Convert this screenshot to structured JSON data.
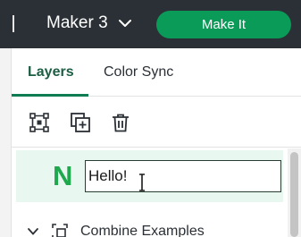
{
  "topbar": {
    "device_name": "Maker 3",
    "device_dropdown_icon": "chevron-down-icon",
    "make_button_label": "Make It",
    "accent_color": "#0a9b58"
  },
  "tabs": [
    {
      "label": "Layers",
      "active": true
    },
    {
      "label": "Color Sync",
      "active": false
    }
  ],
  "toolbar": {
    "icons": [
      "group-nodes-icon",
      "duplicate-icon",
      "trash-icon"
    ]
  },
  "layers": [
    {
      "letter": "N",
      "name_value": "Hello!",
      "editing": true,
      "letter_color": "#1fa84d"
    },
    {
      "label": "Combine Examples",
      "icon": "combine-group-icon",
      "expanded": true
    }
  ]
}
